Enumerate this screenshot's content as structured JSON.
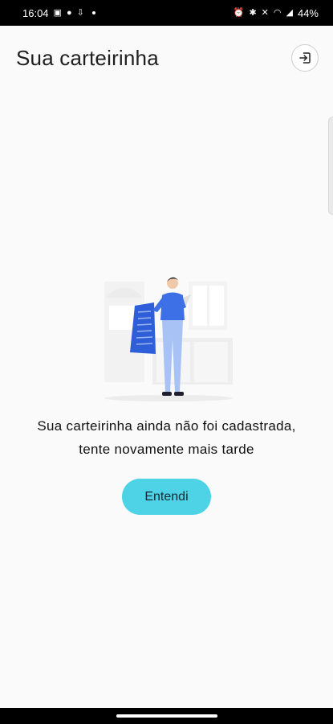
{
  "status_bar": {
    "time": "16:04",
    "battery": "44%",
    "left_icons": [
      "gallery-icon",
      "messenger-icon",
      "download-icon",
      "dot-icon"
    ],
    "right_icons": [
      "alarm-icon",
      "bluetooth-icon",
      "mute-icon",
      "wifi-icon",
      "signal-icon"
    ]
  },
  "header": {
    "title": "Sua carteirinha",
    "exit_icon": "logout-icon"
  },
  "empty_state": {
    "line1": "Sua carteirinha ainda não foi cadastrada,",
    "line2": "tente novamente mais tarde"
  },
  "actions": {
    "confirm_label": "Entendi"
  },
  "colors": {
    "accent": "#4dd2e6",
    "background": "#fafafa",
    "figure_shirt": "#3d6fe6",
    "figure_pants": "#a9c2f5"
  }
}
